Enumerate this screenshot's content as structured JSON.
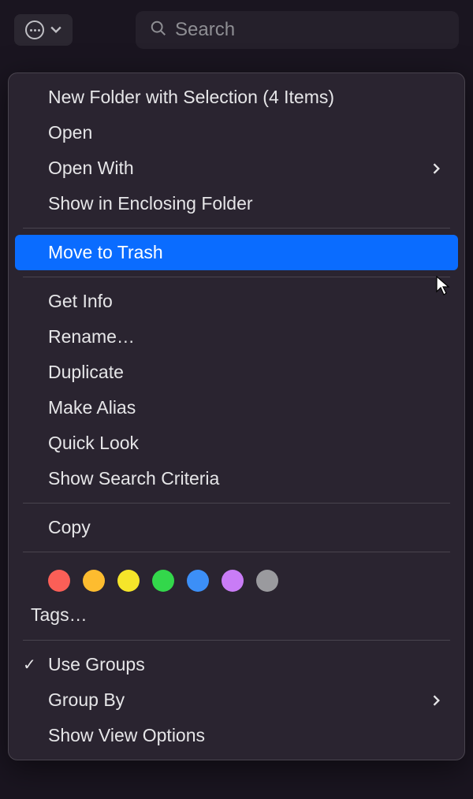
{
  "toolbar": {
    "search_placeholder": "Search"
  },
  "menu": {
    "new_folder": "New Folder with Selection (4 Items)",
    "open": "Open",
    "open_with": "Open With",
    "show_enclosing": "Show in Enclosing Folder",
    "move_to_trash": "Move to Trash",
    "get_info": "Get Info",
    "rename": "Rename…",
    "duplicate": "Duplicate",
    "make_alias": "Make Alias",
    "quick_look": "Quick Look",
    "show_search_criteria": "Show Search Criteria",
    "copy": "Copy",
    "tags": "Tags…",
    "use_groups": "Use Groups",
    "group_by": "Group By",
    "show_view_options": "Show View Options"
  },
  "tag_colors": {
    "red": "#fb5f57",
    "orange": "#fdbc2f",
    "yellow": "#f5e52a",
    "green": "#33d74b",
    "blue": "#3c8ff7",
    "purple": "#c97cf6",
    "gray": "#9a9a9e"
  }
}
